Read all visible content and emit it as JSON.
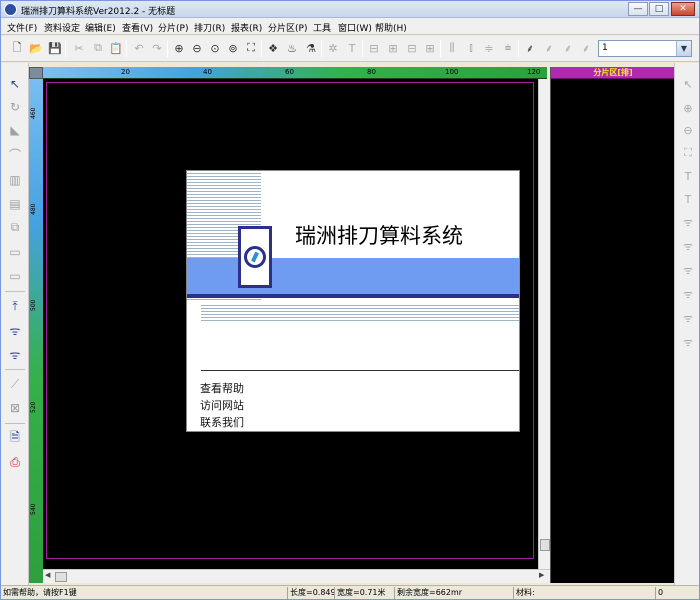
{
  "window": {
    "title": "瑞洲排刀算料系统Ver2012.2 - 无标题",
    "minimize_glyph": "—",
    "maximize_glyph": "□",
    "close_glyph": "✕"
  },
  "menu": [
    {
      "label": "文件(F)"
    },
    {
      "label": "资料设定"
    },
    {
      "label": "编辑(E)"
    },
    {
      "label": "查看(V)"
    },
    {
      "label": "分片(P)"
    },
    {
      "label": "排刀(R)"
    },
    {
      "label": "报表(R)"
    },
    {
      "label": "分片区(P)"
    },
    {
      "label": "工具"
    },
    {
      "label": "窗口(W)"
    },
    {
      "label": "帮助(H)"
    }
  ],
  "toolbar": {
    "layer_value": "1",
    "combo_arrow": "▼",
    "icons": [
      "new-file-icon",
      "open-folder-icon",
      "save-icon",
      "cut-icon",
      "copy-icon",
      "paste-icon",
      "undo-icon",
      "redo-icon",
      "zoom-in-icon",
      "zoom-out-icon",
      "zoom-window-icon",
      "zoom-reset-icon",
      "zoom-fit-icon",
      "layout-icon",
      "layout-alt-icon",
      "layout-more-icon",
      "gear-icon",
      "text-icon",
      "align-left-icon",
      "align-top-icon",
      "align-bottom-icon",
      "align-right-icon",
      "distribute-h-icon",
      "distribute-center-icon",
      "distribute-v-icon",
      "distribute-bottom-icon",
      "knife-icon",
      "knife-alt-icon",
      "knife-dim-icon",
      "knife-dim2-icon"
    ]
  },
  "ruler": {
    "h_labels": [
      "20",
      "40",
      "60",
      "80",
      "100",
      "120"
    ],
    "v_labels": [
      "460",
      "480",
      "500",
      "520",
      "540"
    ]
  },
  "right_panel": {
    "title": "分片区[排]"
  },
  "splash": {
    "title": "瑞洲排刀算料系统",
    "links": [
      "查看帮助",
      "访问网站",
      "联系我们"
    ]
  },
  "status": {
    "help_text": "如需帮助，请按F1键",
    "length_text": "长度=0.849",
    "width_text": "宽度=0.71米",
    "remaining_text": "剩余宽度=662mr",
    "material_label": "材料:",
    "count_value": "0"
  },
  "colors": {
    "canvas": "#000000",
    "frame": "#9b1e9b",
    "panel_header": "#b02ab0",
    "panel_header_text": "#f4f01a",
    "splash_band": "#6f9cf1",
    "splash_navy": "#2c2f8c"
  }
}
